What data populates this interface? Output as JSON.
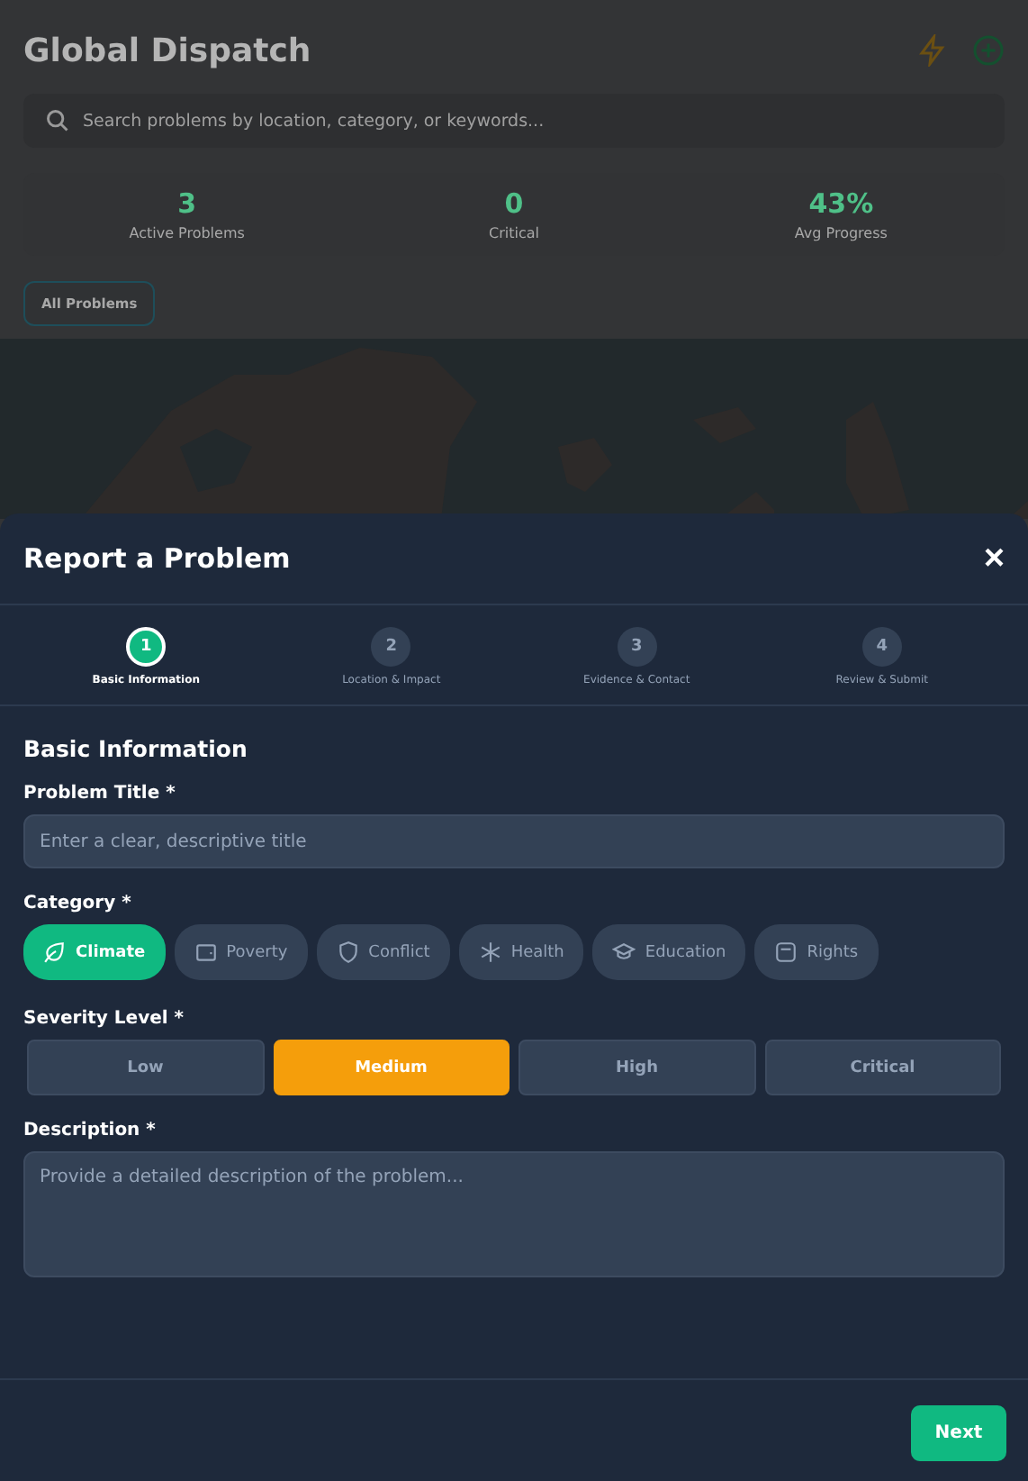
{
  "page": {
    "title": "Global Dispatch",
    "search": {
      "placeholder": "Search problems by location, category, or keywords..."
    },
    "stats": [
      {
        "value": "3",
        "label": "Active Problems"
      },
      {
        "value": "0",
        "label": "Critical"
      },
      {
        "value": "43%",
        "label": "Avg Progress"
      }
    ],
    "filters": [
      {
        "label": "All Problems",
        "selected": true
      }
    ]
  },
  "modal": {
    "title": "Report a Problem",
    "close": "×",
    "steps": [
      {
        "number": "1",
        "label": "Basic Information",
        "selected": true
      },
      {
        "number": "2",
        "label": "Location & Impact",
        "selected": false
      },
      {
        "number": "3",
        "label": "Evidence & Contact",
        "selected": false
      },
      {
        "number": "4",
        "label": "Review & Submit",
        "selected": false
      }
    ],
    "section_title": "Basic Information",
    "title_field": {
      "label": "Problem Title *",
      "placeholder": "Enter a clear, descriptive title"
    },
    "category": {
      "label": "Category *",
      "options": [
        {
          "label": "Climate",
          "selected": true
        },
        {
          "label": "Poverty",
          "selected": false
        },
        {
          "label": "Conflict",
          "selected": false
        },
        {
          "label": "Health",
          "selected": false
        },
        {
          "label": "Education",
          "selected": false
        },
        {
          "label": "Rights",
          "selected": false
        }
      ]
    },
    "severity": {
      "label": "Severity Level *",
      "options": [
        {
          "label": "Low",
          "selected": false
        },
        {
          "label": "Medium",
          "selected": true
        },
        {
          "label": "High",
          "selected": false
        },
        {
          "label": "Critical",
          "selected": false
        }
      ]
    },
    "description": {
      "label": "Description *",
      "placeholder": "Provide a detailed description of the problem..."
    },
    "next": "Next"
  }
}
